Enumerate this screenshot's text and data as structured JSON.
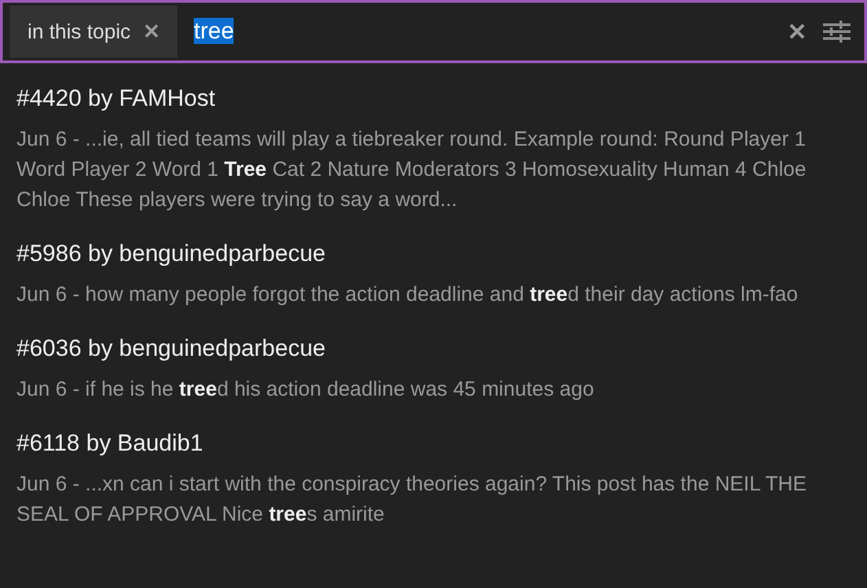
{
  "search": {
    "scope_chip": {
      "label": "in this topic",
      "remove_icon": "✕"
    },
    "query": {
      "value": "tree",
      "selected": true
    },
    "clear_icon": "✕"
  },
  "results": [
    {
      "title": "#4420 by FAMHost",
      "snippet": "Jun 6 - ...ie, all tied teams will play a tiebreaker round. Example round: Round Player 1 Word Player 2 Word 1 **Tree** Cat 2 Nature Moderators 3 Homosexuality Human 4 Chloe Chloe These players were trying to say a word..."
    },
    {
      "title": "#5986 by benguinedparbecue",
      "snippet": "Jun 6 - how many people forgot the action deadline and **tree**d their day actions lm-fao"
    },
    {
      "title": "#6036 by benguinedparbecue",
      "snippet": "Jun 6 - if he is he **tree**d his action deadline was 45 minutes ago"
    },
    {
      "title": "#6118 by Baudib1",
      "snippet": "Jun 6 - ...xn can i start with the conspiracy theories again? This post has the NEIL THE SEAL OF APPROVAL Nice **tree**s amirite"
    }
  ]
}
